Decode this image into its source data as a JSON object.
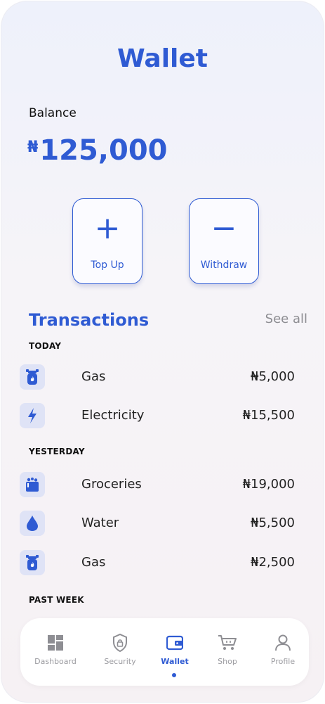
{
  "header": {
    "title": "Wallet"
  },
  "balance": {
    "label": "Balance",
    "currency_symbol": "₦",
    "amount": "125,000"
  },
  "actions": {
    "top_up_label": "Top Up",
    "top_up_symbol": "+",
    "withdraw_label": "Withdraw",
    "withdraw_symbol": "−"
  },
  "transactions": {
    "title": "Transactions",
    "see_all": "See all",
    "sections": [
      {
        "label": "TODAY",
        "items": [
          {
            "name": "Gas",
            "amount": "₦5,000",
            "icon": "gas-cylinder-icon"
          },
          {
            "name": "Electricity",
            "amount": "₦15,500",
            "icon": "lightning-icon"
          }
        ]
      },
      {
        "label": "YESTERDAY",
        "items": [
          {
            "name": "Groceries",
            "amount": "₦19,000",
            "icon": "groceries-icon"
          },
          {
            "name": "Water",
            "amount": "₦5,500",
            "icon": "water-drop-icon"
          },
          {
            "name": "Gas",
            "amount": "₦2,500",
            "icon": "gas-cylinder-icon"
          }
        ]
      },
      {
        "label": "PAST WEEK",
        "items": []
      }
    ]
  },
  "nav": {
    "items": [
      {
        "label": "Dashboard",
        "icon": "dashboard-icon"
      },
      {
        "label": "Security",
        "icon": "shield-icon"
      },
      {
        "label": "Wallet",
        "icon": "wallet-icon",
        "active": true
      },
      {
        "label": "Shop",
        "icon": "cart-icon"
      },
      {
        "label": "Profile",
        "icon": "user-icon"
      }
    ]
  },
  "colors": {
    "accent": "#2f5bd3",
    "icon_bg": "#dfe3f6",
    "muted": "#9b9ba0"
  }
}
